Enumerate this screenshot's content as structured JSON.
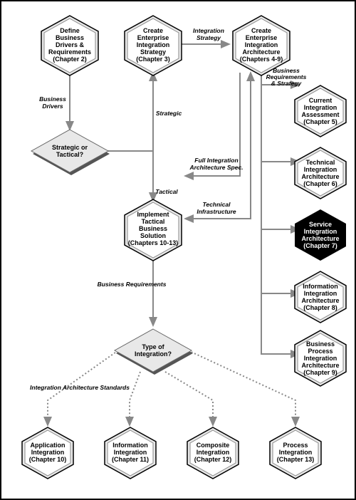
{
  "nodes": {
    "define": {
      "l1": "Define",
      "l2": "Business",
      "l3": "Drivers &",
      "l4": "Requirements",
      "l5": "(Chapter 2)"
    },
    "strategy": {
      "l1": "Create",
      "l2": "Enterprise",
      "l3": "Integration",
      "l4": "Strategy",
      "l5": "(Chapter 3)"
    },
    "arch": {
      "l1": "Create",
      "l2": "Enterprise",
      "l3": "Integration",
      "l4": "Architecture",
      "l5": "(Chapters 4-9)"
    },
    "assess": {
      "l1": "Current",
      "l2": "Integration",
      "l3": "Assessment",
      "l4": "(Chapter 5)"
    },
    "tech": {
      "l1": "Technical",
      "l2": "Integration",
      "l3": "Architecture",
      "l4": "(Chapter 6)"
    },
    "service": {
      "l1": "Service",
      "l2": "Integration",
      "l3": "Architecture",
      "l4": "(Chapter 7)"
    },
    "info": {
      "l1": "Information",
      "l2": "Integration",
      "l3": "Architecture",
      "l4": "(Chapter 8)"
    },
    "biz": {
      "l1": "Business",
      "l2": "Process",
      "l3": "Integration",
      "l4": "Architecture",
      "l5": "(Chapter 9)"
    },
    "tactical": {
      "l1": "Implement",
      "l2": "Tactical",
      "l3": "Business",
      "l4": "Solution",
      "l5": "(Chapters 10-13)"
    },
    "app10": {
      "l1": "Application",
      "l2": "Integration",
      "l3": "(Chapter 10)"
    },
    "info11": {
      "l1": "Information",
      "l2": "Integration",
      "l3": "(Chapter 11)"
    },
    "comp12": {
      "l1": "Composite",
      "l2": "Integration",
      "l3": "(Chapter 12)"
    },
    "proc13": {
      "l1": "Process",
      "l2": "Integration",
      "l3": "(Chapter 13)"
    },
    "decision1": {
      "l1": "Strategic or",
      "l2": "Tactical?"
    },
    "decision2": {
      "l1": "Type of",
      "l2": "Integration?"
    }
  },
  "labels": {
    "intStrat": "Integration\nStrategy",
    "bizDrivers": "Business\nDrivers",
    "strategic": "Strategic",
    "tactical": "Tactical",
    "reqStrat": "Business\nRequirements\n& Strategy",
    "fullSpec": "Full Integration\nArchitecture Spec.",
    "techInfra": "Technical\nInfrastructure",
    "bizReq": "Business Requirements",
    "archStd": "Integration Architecture Standards"
  }
}
